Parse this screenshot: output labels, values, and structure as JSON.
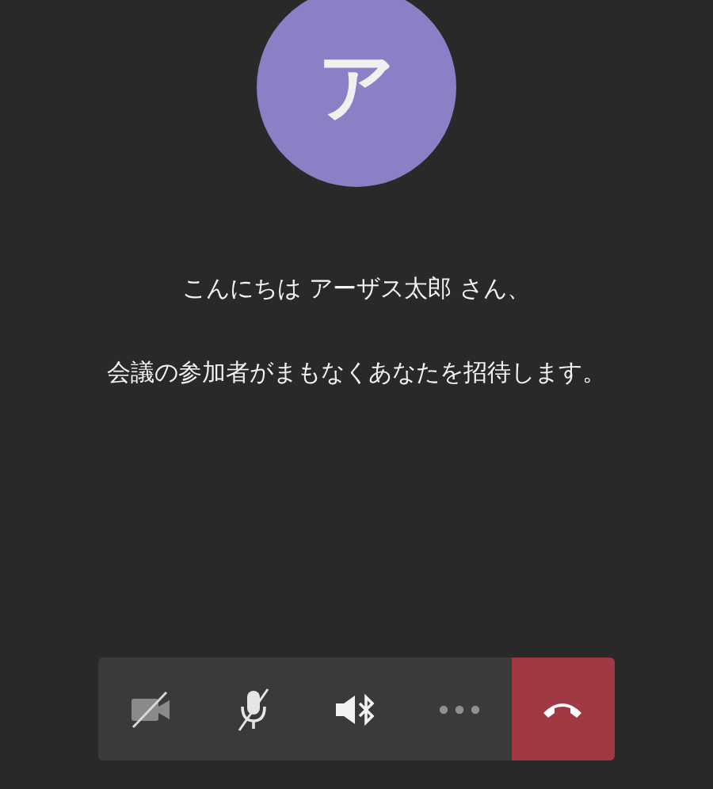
{
  "avatar": {
    "initial": "ア"
  },
  "greeting": "こんにちは アーザス太郎 さん、",
  "message": "会議の参加者がまもなくあなたを招待します。",
  "controls": [
    {
      "kind": "camera",
      "on": false
    },
    {
      "kind": "mic",
      "on": false
    },
    {
      "kind": "speaker"
    },
    {
      "kind": "more"
    },
    {
      "kind": "hangup"
    }
  ]
}
